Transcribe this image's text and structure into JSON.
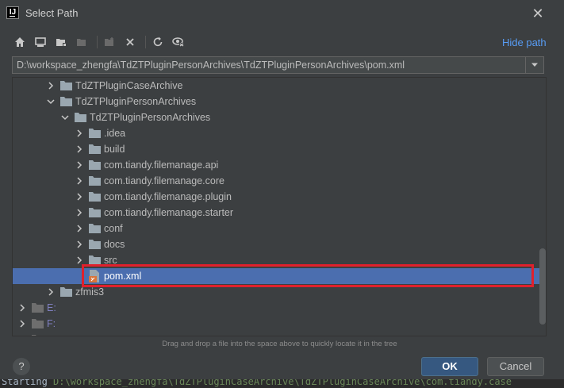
{
  "window": {
    "title": "Select Path"
  },
  "toolbar": {
    "hide_path": "Hide path",
    "buttons": [
      "home-icon",
      "desktop-icon",
      "project-folder-icon",
      "module-folder-icon",
      "new-folder-icon",
      "delete-icon",
      "refresh-icon",
      "show-hidden-icon"
    ]
  },
  "path": {
    "value": "D:\\workspace_zhengfa\\TdZTPluginPersonArchives\\TdZTPluginPersonArchives\\pom.xml"
  },
  "tree": {
    "items": [
      {
        "label": "TdZTPluginCaseArchive",
        "expanded": false
      },
      {
        "label": "TdZTPluginPersonArchives",
        "expanded": true
      },
      {
        "label": "TdZTPluginPersonArchives",
        "expanded": true
      },
      {
        "label": ".idea",
        "expanded": false
      },
      {
        "label": "build",
        "expanded": false
      },
      {
        "label": "com.tiandy.filemanage.api",
        "expanded": false
      },
      {
        "label": "com.tiandy.filemanage.core",
        "expanded": false
      },
      {
        "label": "com.tiandy.filemanage.plugin",
        "expanded": false
      },
      {
        "label": "com.tiandy.filemanage.starter",
        "expanded": false
      },
      {
        "label": "conf",
        "expanded": false
      },
      {
        "label": "docs",
        "expanded": false
      },
      {
        "label": "src",
        "expanded": false
      },
      {
        "label": "pom.xml",
        "selected": true
      },
      {
        "label": "zfmis3",
        "expanded": false
      },
      {
        "label": "E:",
        "expanded": false
      },
      {
        "label": "F:",
        "expanded": false
      },
      {
        "label": "X:",
        "expanded": false
      }
    ]
  },
  "hint": "Drag and drop a file into the space above to quickly locate it in the tree",
  "buttons": {
    "help": "?",
    "ok": "OK",
    "cancel": "Cancel"
  },
  "console": {
    "prefix": "Starting ",
    "path": "D:\\workspace_zhengfa\\TdZTPluginCaseArchive\\TdZTPluginCaseArchive\\com.tiandy.case"
  },
  "colors": {
    "selection": "#4b6eaf",
    "highlight_box": "#e0202c",
    "link": "#589df6"
  }
}
